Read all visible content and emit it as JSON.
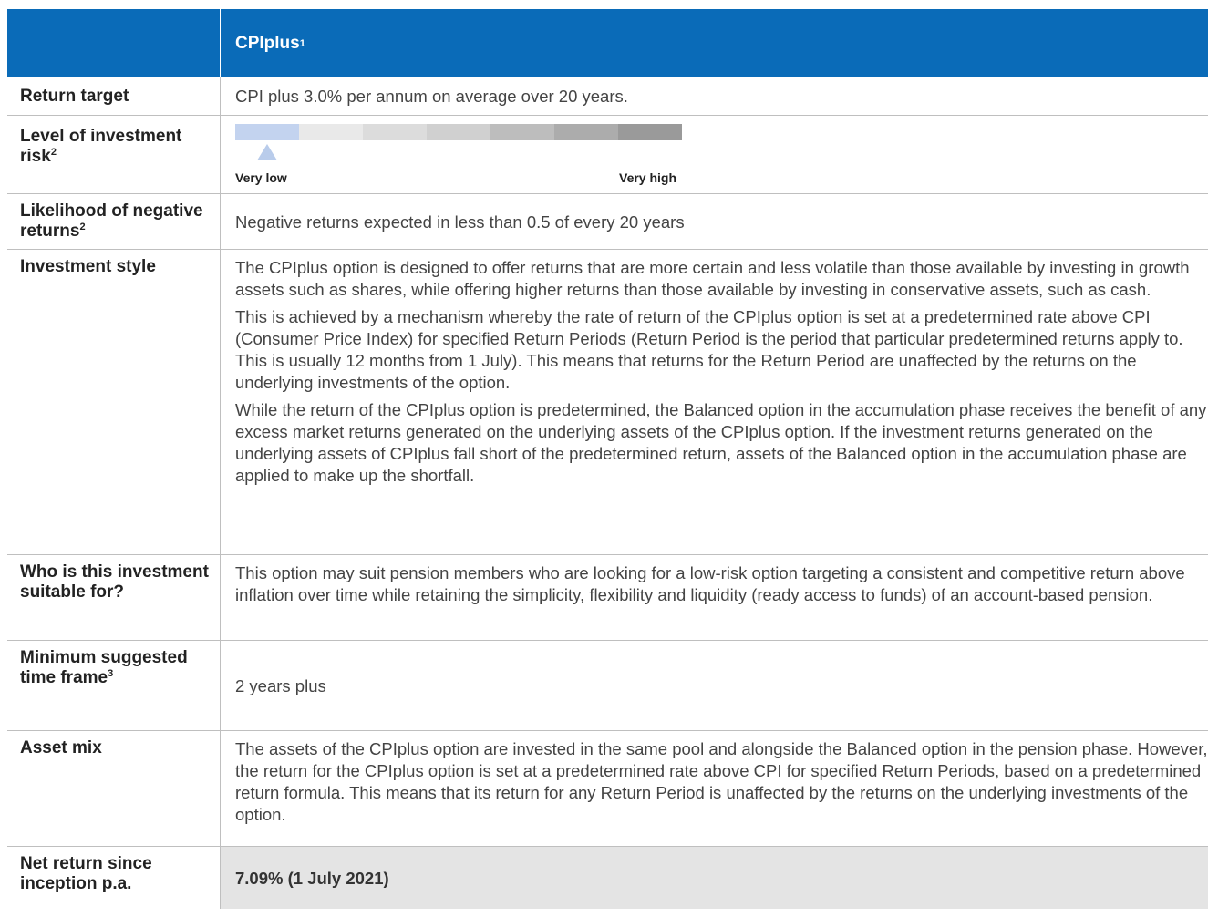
{
  "header": {
    "option_name": "CPIplus",
    "option_sup": "1"
  },
  "rows": {
    "return_target": {
      "label": "Return target",
      "value": "CPI plus 3.0% per annum on average over 20 years."
    },
    "risk": {
      "label": "Level of investment risk",
      "label_sup": "2",
      "low_label": "Very low",
      "high_label": "Very high",
      "selected_level": 1,
      "total_levels": 7,
      "segment_colors": [
        "#c3d3ef",
        "#e9e9e9",
        "#dcdcdc",
        "#d0d0d0",
        "#bdbdbd",
        "#acacac",
        "#9a9a9a"
      ]
    },
    "negative": {
      "label": "Likelihood of negative returns",
      "label_sup": "2",
      "value": "Negative returns expected in less than 0.5 of every 20 years"
    },
    "style": {
      "label": "Investment style",
      "p1": "The CPIplus option is designed to offer returns that are more certain and less volatile than those available by investing in growth assets such as shares, while offering higher returns than those available by investing in conservative assets, such as cash.",
      "p2": "This is achieved by a mechanism whereby the rate of return of the CPIplus option is set at a predetermined rate above CPI (Consumer Price Index) for specified Return Periods (Return Period is the period that particular predetermined returns apply to. This is usually 12 months from 1 July). This means that returns for the Return Period are unaffected by the returns on the underlying investments of the option.",
      "p3": "While the return of the CPIplus option is predetermined, the Balanced option in the accumulation phase receives the benefit of any excess market returns generated on the underlying assets of the CPIplus option. If the investment returns generated on the underlying assets of CPIplus fall short of the predetermined return, assets of the Balanced option in the accumulation phase are applied to make up the shortfall."
    },
    "suitable": {
      "label": "Who is this investment suitable for?",
      "value": "This option may suit pension members who are looking for a low-risk option targeting a consistent and competitive return above inflation over time while retaining the simplicity, flexibility and liquidity (ready access to funds) of an account-based pension."
    },
    "timeframe": {
      "label": "Minimum suggested time frame",
      "label_sup": "3",
      "value": "2 years plus"
    },
    "asset_mix": {
      "label": "Asset mix",
      "value": "The assets of the CPIplus option are invested in the same pool and alongside the Balanced option in the pension phase. However, the return for the CPIplus option is set at a predetermined rate above CPI for specified Return Periods, based on a predetermined return formula. This means that its return for any Return Period is unaffected by the returns on the underlying investments of the option."
    },
    "net_return": {
      "label": "Net return since inception p.a.",
      "value": "7.09% (1 July 2021)"
    }
  }
}
